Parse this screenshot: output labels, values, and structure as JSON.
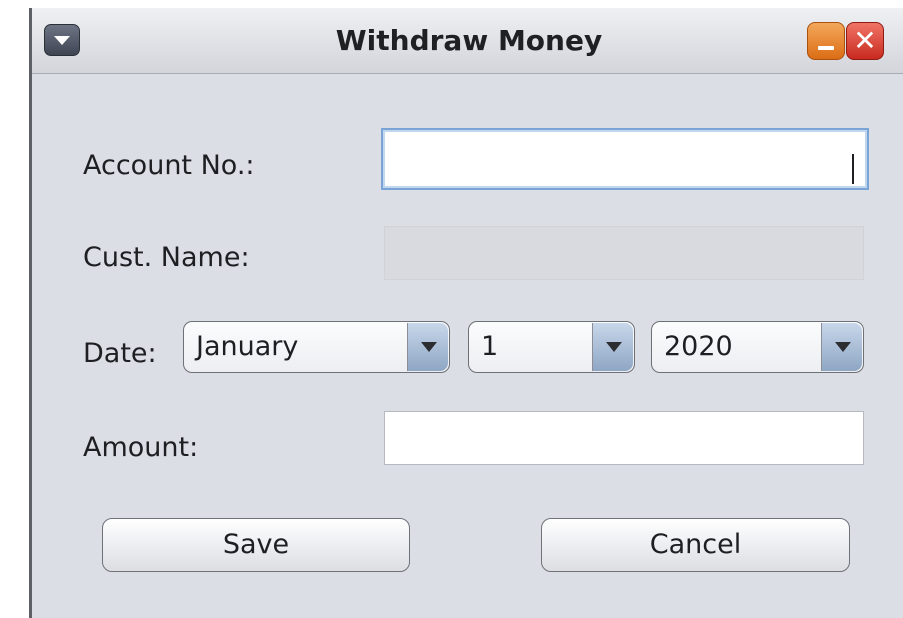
{
  "window": {
    "title": "Withdraw Money",
    "close_glyph": "✕",
    "icons": [
      "window-menu-icon",
      "minimize-icon",
      "close-icon",
      "chevron-down-icon"
    ]
  },
  "form": {
    "account_label": "Account No.:",
    "account_value": "",
    "cust_name_label": "Cust. Name:",
    "cust_name_value": "",
    "date_label": "Date:",
    "month_selected": "January",
    "day_selected": "1",
    "year_selected": "2020",
    "amount_label": "Amount:",
    "amount_value": ""
  },
  "buttons": {
    "save": "Save",
    "cancel": "Cancel"
  },
  "colors": {
    "window_bg": "#dcdee6",
    "focus_border": "#7aa4d6",
    "minimize": "#e8822e",
    "close": "#de4a3c"
  }
}
